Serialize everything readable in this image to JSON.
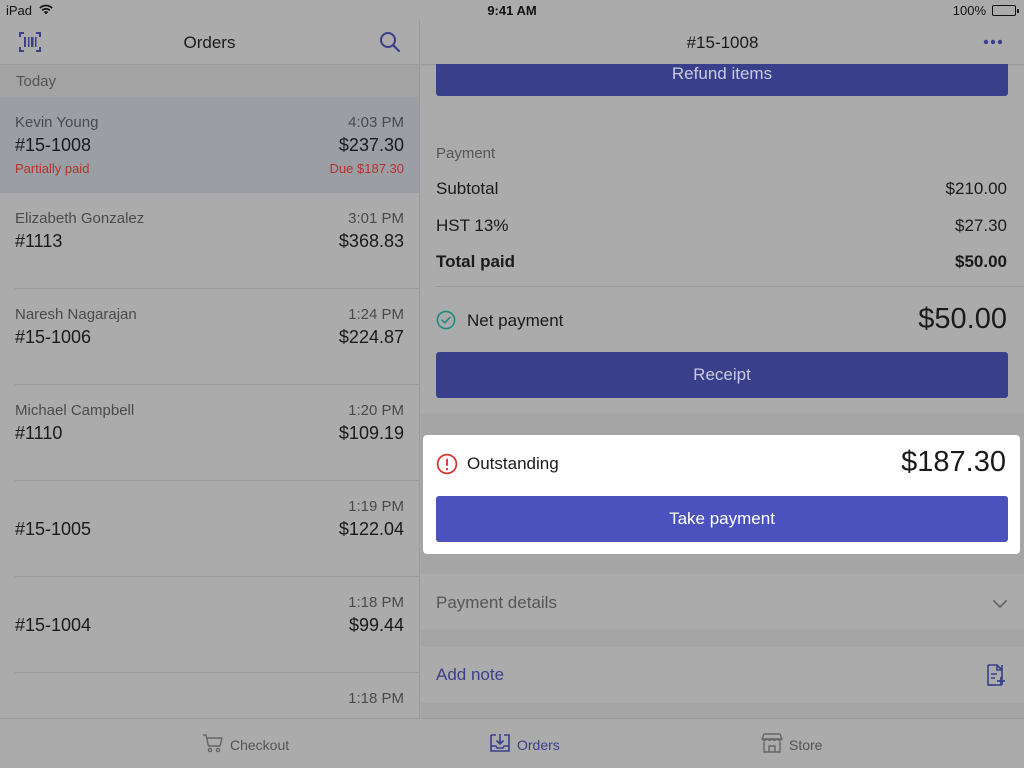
{
  "status_bar": {
    "device": "iPad",
    "time": "9:41 AM",
    "battery": "100%"
  },
  "left": {
    "title": "Orders",
    "section": "Today",
    "orders": [
      {
        "name": "Kevin Young",
        "time": "4:03 PM",
        "number": "#15-1008",
        "amount": "$237.30",
        "status": "Partially paid",
        "due": "Due $187.30"
      },
      {
        "name": "Elizabeth Gonzalez",
        "time": "3:01 PM",
        "number": "#1113",
        "amount": "$368.83"
      },
      {
        "name": "Naresh Nagarajan",
        "time": "1:24 PM",
        "number": "#15-1006",
        "amount": "$224.87"
      },
      {
        "name": "Michael Campbell",
        "time": "1:20 PM",
        "number": "#1110",
        "amount": "$109.19"
      },
      {
        "name": "",
        "time": "1:19 PM",
        "number": "#15-1005",
        "amount": "$122.04"
      },
      {
        "name": "",
        "time": "1:18 PM",
        "number": "#15-1004",
        "amount": "$99.44"
      },
      {
        "name": "",
        "time": "1:18 PM",
        "number": "",
        "amount": ""
      }
    ]
  },
  "right": {
    "title": "#15-1008",
    "refund_label": "Refund items",
    "payment": {
      "label": "Payment",
      "subtotal_label": "Subtotal",
      "subtotal": "$210.00",
      "tax_label": "HST 13%",
      "tax": "$27.30",
      "total_paid_label": "Total paid",
      "total_paid": "$50.00",
      "net_label": "Net payment",
      "net": "$50.00",
      "receipt_label": "Receipt"
    },
    "outstanding": {
      "label": "Outstanding",
      "amount": "$187.30",
      "button": "Take payment"
    },
    "payment_details_label": "Payment details",
    "add_note_label": "Add note"
  },
  "tabs": [
    {
      "label": "Checkout",
      "icon": "cart-icon"
    },
    {
      "label": "Orders",
      "icon": "orders-icon",
      "active": true
    },
    {
      "label": "Store",
      "icon": "store-icon"
    }
  ],
  "colors": {
    "accent": "#3a3f8c",
    "take_payment": "#4b52bd",
    "warning": "#d0342c",
    "success": "#1f8a82"
  }
}
